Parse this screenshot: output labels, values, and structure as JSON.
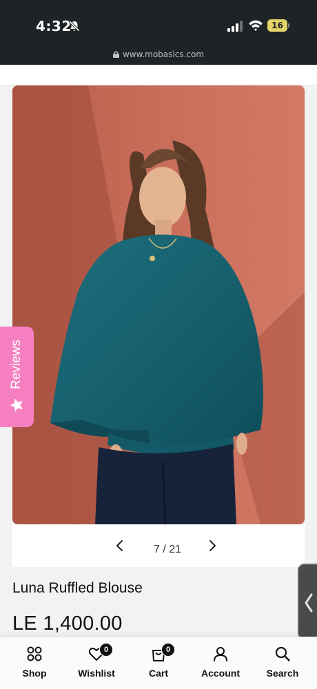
{
  "status_bar": {
    "time": "4:32",
    "battery": "16",
    "url": "www.mobasics.com"
  },
  "gallery": {
    "counter": "7 / 21"
  },
  "product": {
    "title": "Luna Ruffled Blouse",
    "price": "LE 1,400.00"
  },
  "reviews_tab": {
    "label": "Reviews"
  },
  "bottom_nav": {
    "shop": "Shop",
    "wishlist": "Wishlist",
    "wishlist_count": "0",
    "cart": "Cart",
    "cart_count": "0",
    "account": "Account",
    "search": "Search"
  }
}
